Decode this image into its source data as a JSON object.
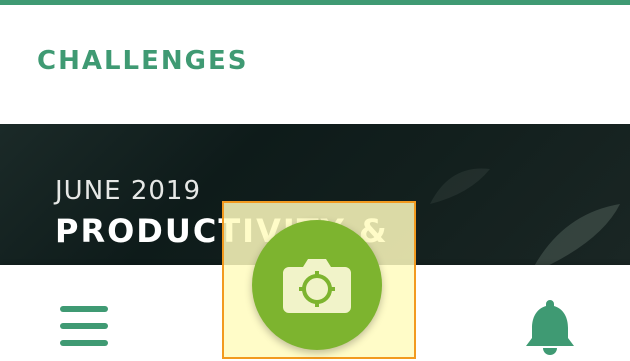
{
  "section": {
    "title": "CHALLENGES"
  },
  "banner": {
    "date": "JUNE 2019",
    "title": "PRODUCTIVITY &"
  },
  "bottom_nav": {
    "menu_icon": "hamburger-menu-icon",
    "camera_icon": "camera-icon",
    "bell_icon": "bell-icon"
  },
  "colors": {
    "accent": "#3f9a73",
    "camera_button": "#7db42f",
    "highlight_border": "#f29a1f",
    "highlight_fill": "#fffcbe"
  }
}
